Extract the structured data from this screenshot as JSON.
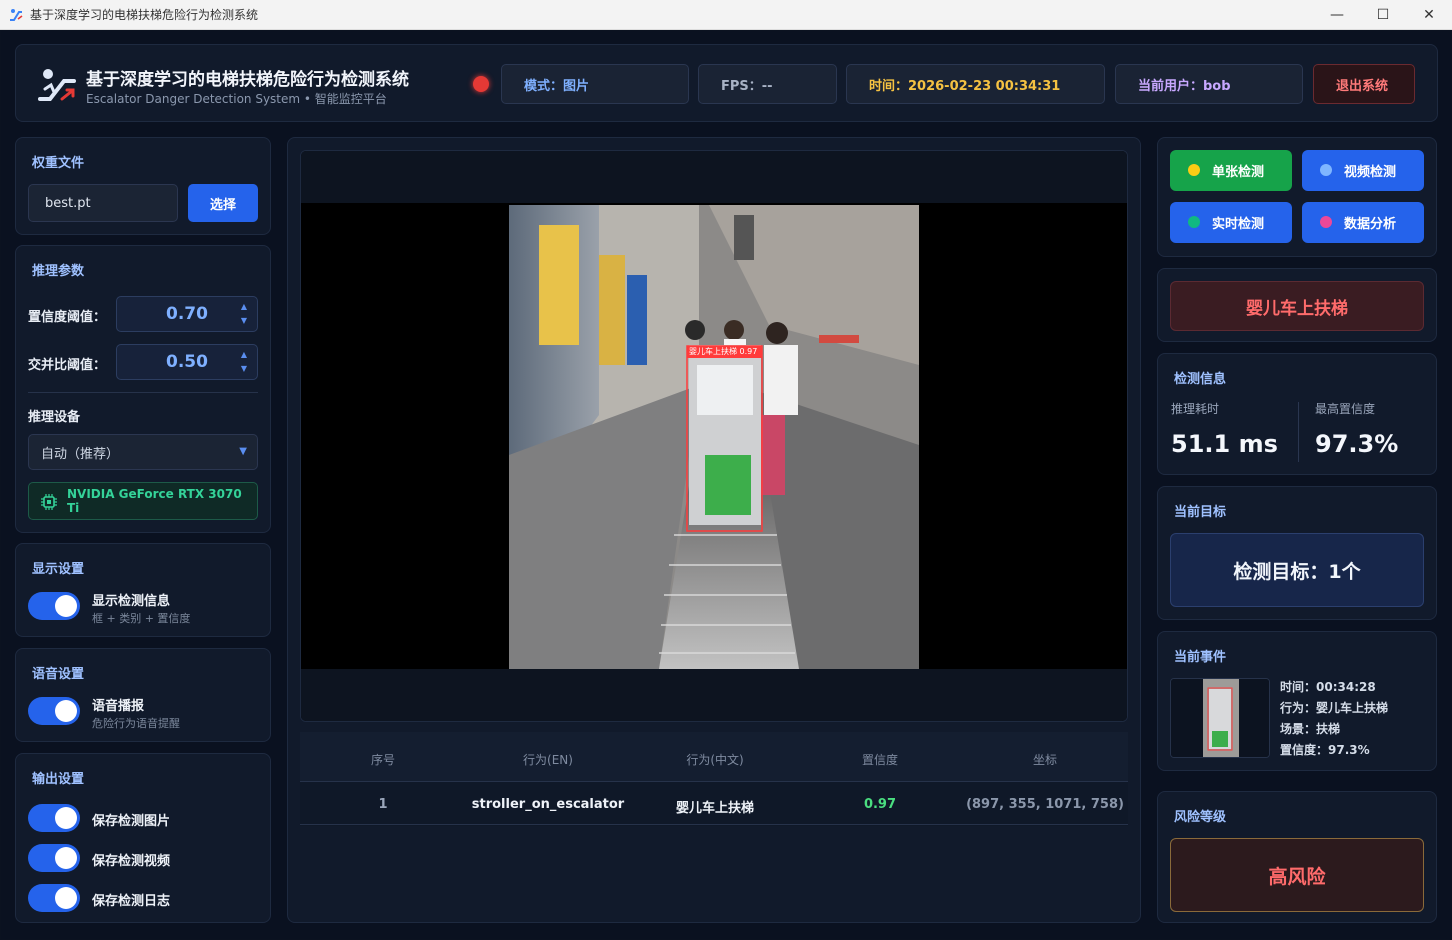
{
  "window": {
    "title": "基于深度学习的电梯扶梯危险行为检测系统"
  },
  "header": {
    "title": "基于深度学习的电梯扶梯危险行为检测系统",
    "subtitle": "Escalator Danger Detection System • 智能监控平台",
    "mode": "模式：图片",
    "fps": "FPS：--",
    "time": "时间：2026-02-23 00:34:31",
    "user": "当前用户：bob",
    "logout": "退出系统",
    "recording_color": "#e53935"
  },
  "weights": {
    "title": "权重文件",
    "value": "best.pt",
    "select_label": "选择"
  },
  "inference": {
    "title": "推理参数",
    "conf_label": "置信度阈值：",
    "conf_value": "0.70",
    "iou_label": "交并比阈值：",
    "iou_value": "0.50",
    "device_title": "推理设备",
    "device_value": "自动（推荐）",
    "gpu_name": "NVIDIA GeForce RTX 3070 Ti"
  },
  "display": {
    "title": "显示设置",
    "toggle_label": "显示检测信息",
    "toggle_sub": "框 + 类别 + 置信度",
    "enabled": true
  },
  "voice": {
    "title": "语音设置",
    "toggle_label": "语音播报",
    "toggle_sub": "危险行为语音提醒",
    "enabled": true
  },
  "output": {
    "title": "输出设置",
    "items": [
      {
        "label": "保存检测图片",
        "enabled": true
      },
      {
        "label": "保存检测视频",
        "enabled": true
      },
      {
        "label": "保存检测日志",
        "enabled": true
      }
    ]
  },
  "viewer": {
    "detection_label": "婴儿车上扶梯 0.97"
  },
  "results_table": {
    "headers": [
      "序号",
      "行为(EN)",
      "行为(中文)",
      "置信度",
      "坐标"
    ],
    "rows": [
      [
        "1",
        "stroller_on_escalator",
        "婴儿车上扶梯",
        "0.97",
        "(897, 355, 1071, 758)"
      ]
    ]
  },
  "modes": [
    {
      "label": "单张检测",
      "bg": "#16a34a",
      "dot": "#facc15"
    },
    {
      "label": "视频检测",
      "bg": "#2563eb",
      "dot": "#7fb6ff"
    },
    {
      "label": "实时检测",
      "bg": "#2563eb",
      "dot": "#10b981"
    },
    {
      "label": "数据分析",
      "bg": "#2563eb",
      "dot": "#ec4899"
    }
  ],
  "alert": {
    "text": "婴儿车上扶梯"
  },
  "detect_info": {
    "title": "检测信息",
    "time_label": "推理耗时",
    "time_value": "51.1 ms",
    "conf_label": "最高置信度",
    "conf_value": "97.3%"
  },
  "target": {
    "title": "当前目标",
    "text": "检测目标：1个"
  },
  "event": {
    "title": "当前事件",
    "time": "时间：00:34:28",
    "behavior": "行为：婴儿车上扶梯",
    "scene": "场景：扶梯",
    "confidence": "置信度：97.3%"
  },
  "risk": {
    "title": "风险等级",
    "text": "高风险"
  }
}
